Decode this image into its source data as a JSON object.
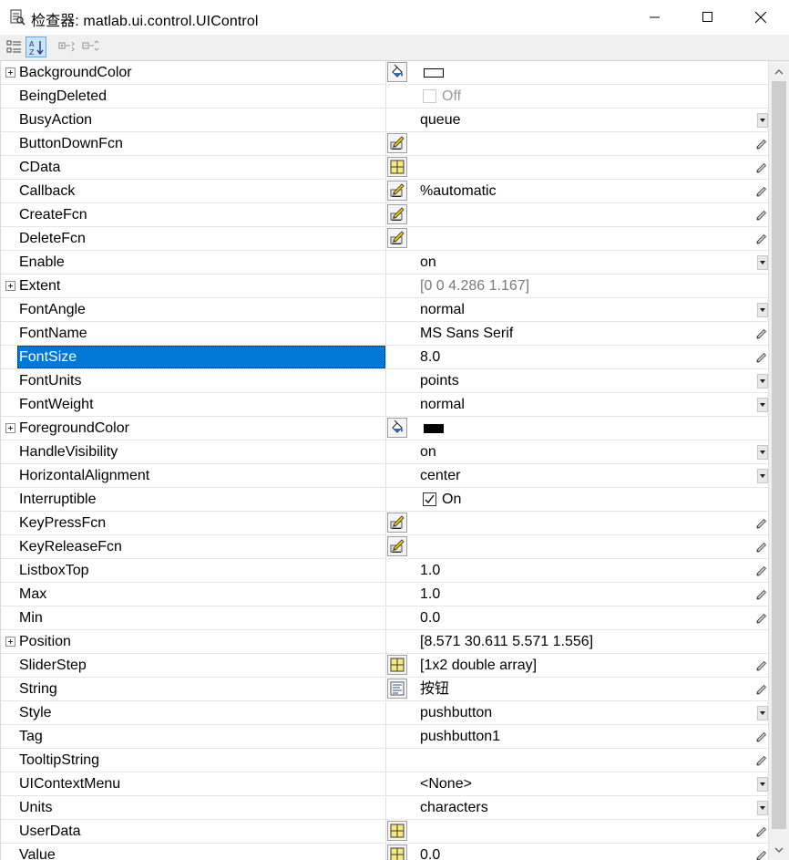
{
  "window": {
    "title": "检查器:  matlab.ui.control.UIControl",
    "minimize_icon": "minimize-icon",
    "maximize_icon": "maximize-icon",
    "close_icon": "close-icon"
  },
  "toolbar": {
    "buttons": [
      {
        "name": "categorized-view-button",
        "icon": "categorized-icon",
        "active": false
      },
      {
        "name": "alphabetical-sort-button",
        "icon": "sort-az-icon",
        "active": true
      },
      {
        "name": "expand-all-button",
        "icon": "expand-all-icon",
        "active": false
      },
      {
        "name": "collapse-all-button",
        "icon": "collapse-all-icon",
        "active": false
      }
    ]
  },
  "properties": [
    {
      "name": "BackgroundColor",
      "expandable": true,
      "button": "color",
      "swatch": "#ffffff",
      "value": "",
      "editor": "none"
    },
    {
      "name": "BeingDeleted",
      "checkbox": false,
      "checkbox_disabled": true,
      "value": "Off",
      "editor": "none"
    },
    {
      "name": "BusyAction",
      "value": "queue",
      "editor": "dropdown"
    },
    {
      "name": "ButtonDownFcn",
      "button": "callback",
      "value": "",
      "editor": "pencil"
    },
    {
      "name": "CData",
      "button": "array",
      "value": "",
      "editor": "pencil"
    },
    {
      "name": "Callback",
      "button": "callback",
      "value": "%automatic",
      "editor": "pencil"
    },
    {
      "name": "CreateFcn",
      "button": "callback",
      "value": "",
      "editor": "pencil"
    },
    {
      "name": "DeleteFcn",
      "button": "callback",
      "value": "",
      "editor": "pencil"
    },
    {
      "name": "Enable",
      "value": "on",
      "editor": "dropdown"
    },
    {
      "name": "Extent",
      "expandable": true,
      "value": "[0 0 4.286 1.167]",
      "value_gray": true,
      "editor": "none"
    },
    {
      "name": "FontAngle",
      "value": "normal",
      "editor": "dropdown"
    },
    {
      "name": "FontName",
      "value": "MS Sans Serif",
      "editor": "pencil"
    },
    {
      "name": "FontSize",
      "value": "8.0",
      "editor": "pencil",
      "selected": true
    },
    {
      "name": "FontUnits",
      "value": "points",
      "editor": "dropdown"
    },
    {
      "name": "FontWeight",
      "value": "normal",
      "editor": "dropdown"
    },
    {
      "name": "ForegroundColor",
      "expandable": true,
      "button": "color",
      "swatch": "#000000",
      "value": "",
      "editor": "none"
    },
    {
      "name": "HandleVisibility",
      "value": "on",
      "editor": "dropdown"
    },
    {
      "name": "HorizontalAlignment",
      "value": "center",
      "editor": "dropdown"
    },
    {
      "name": "Interruptible",
      "checkbox": true,
      "value": "On",
      "editor": "none"
    },
    {
      "name": "KeyPressFcn",
      "button": "callback",
      "value": "",
      "editor": "pencil"
    },
    {
      "name": "KeyReleaseFcn",
      "button": "callback",
      "value": "",
      "editor": "pencil"
    },
    {
      "name": "ListboxTop",
      "value": "1.0",
      "editor": "pencil"
    },
    {
      "name": "Max",
      "value": "1.0",
      "editor": "pencil"
    },
    {
      "name": "Min",
      "value": "0.0",
      "editor": "pencil"
    },
    {
      "name": "Position",
      "expandable": true,
      "value": "[8.571 30.611 5.571 1.556]",
      "editor": "none"
    },
    {
      "name": "SliderStep",
      "button": "array",
      "value": "[1x2  double array]",
      "editor": "pencil"
    },
    {
      "name": "String",
      "button": "text",
      "value": "按钮",
      "editor": "pencil"
    },
    {
      "name": "Style",
      "value": "pushbutton",
      "editor": "dropdown"
    },
    {
      "name": "Tag",
      "value": "pushbutton1",
      "editor": "pencil"
    },
    {
      "name": "TooltipString",
      "value": "",
      "editor": "pencil"
    },
    {
      "name": "UIContextMenu",
      "value": "<None>",
      "editor": "dropdown"
    },
    {
      "name": "Units",
      "value": "characters",
      "editor": "dropdown"
    },
    {
      "name": "UserData",
      "button": "array",
      "value": "",
      "editor": "pencil"
    },
    {
      "name": "Value",
      "button": "array",
      "value": "0.0",
      "editor": "pencil"
    }
  ],
  "colors": {
    "selection": "#0078d7",
    "toolbar_bg": "#f0f0f0"
  }
}
